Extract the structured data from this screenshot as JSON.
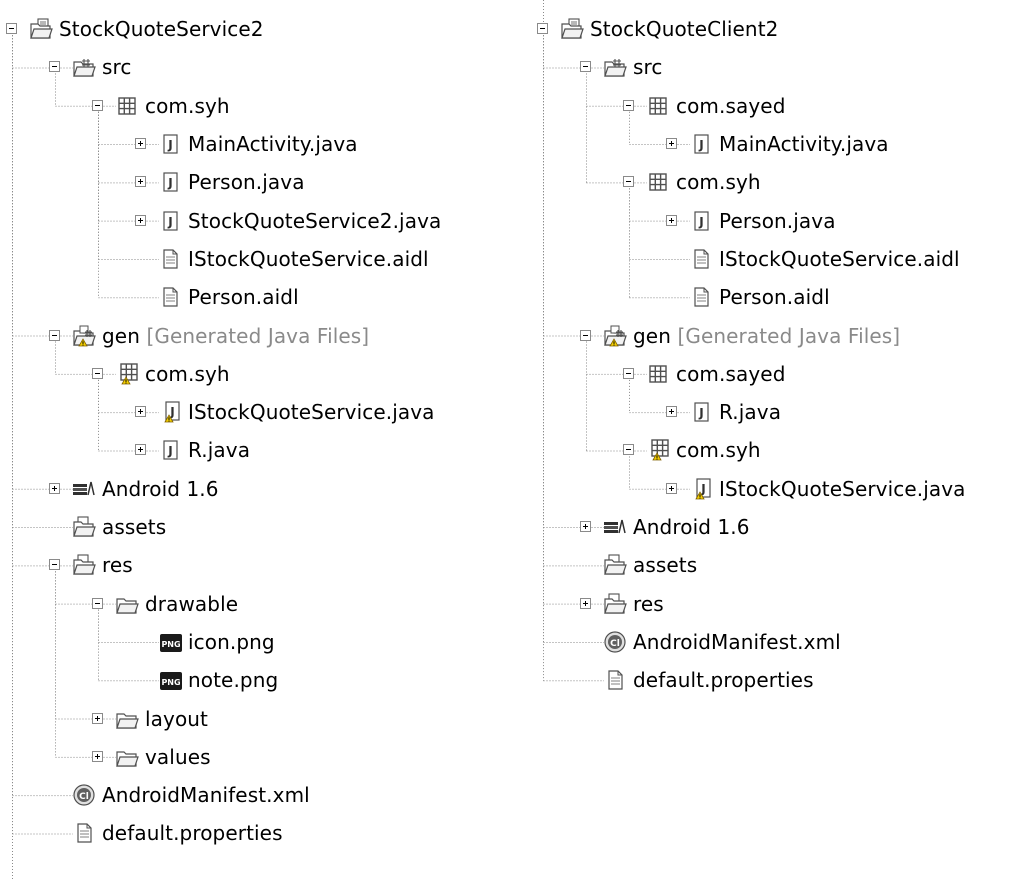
{
  "left_tree": {
    "project": "StockQuoteService2",
    "src": "src",
    "src_pkg": "com.syh",
    "src_files": [
      "MainActivity.java",
      "Person.java",
      "StockQuoteService2.java",
      "IStockQuoteService.aidl",
      "Person.aidl"
    ],
    "gen": "gen",
    "gen_decoration": "[Generated Java Files]",
    "gen_pkg": "com.syh",
    "gen_files": [
      "IStockQuoteService.java",
      "R.java"
    ],
    "library": "Android 1.6",
    "assets": "assets",
    "res": "res",
    "drawable": "drawable",
    "drawable_files": [
      "icon.png",
      "note.png"
    ],
    "layout": "layout",
    "values": "values",
    "manifest": "AndroidManifest.xml",
    "properties": "default.properties"
  },
  "right_tree": {
    "project": "StockQuoteClient2",
    "src": "src",
    "src_pkg1": "com.sayed",
    "src_pkg1_files": [
      "MainActivity.java"
    ],
    "src_pkg2": "com.syh",
    "src_pkg2_files": [
      "Person.java",
      "IStockQuoteService.aidl",
      "Person.aidl"
    ],
    "gen": "gen",
    "gen_decoration": "[Generated Java Files]",
    "gen_pkg1": "com.sayed",
    "gen_pkg1_files": [
      "R.java"
    ],
    "gen_pkg2": "com.syh",
    "gen_pkg2_files": [
      "IStockQuoteService.java"
    ],
    "library": "Android 1.6",
    "assets": "assets",
    "res": "res",
    "manifest": "AndroidManifest.xml",
    "properties": "default.properties"
  },
  "icon_names": [
    "project-icon",
    "source-folder-icon",
    "package-icon",
    "java-file-icon",
    "text-file-icon",
    "gen-folder-icon",
    "library-icon",
    "folder-icon",
    "png-file-icon",
    "manifest-icon"
  ]
}
